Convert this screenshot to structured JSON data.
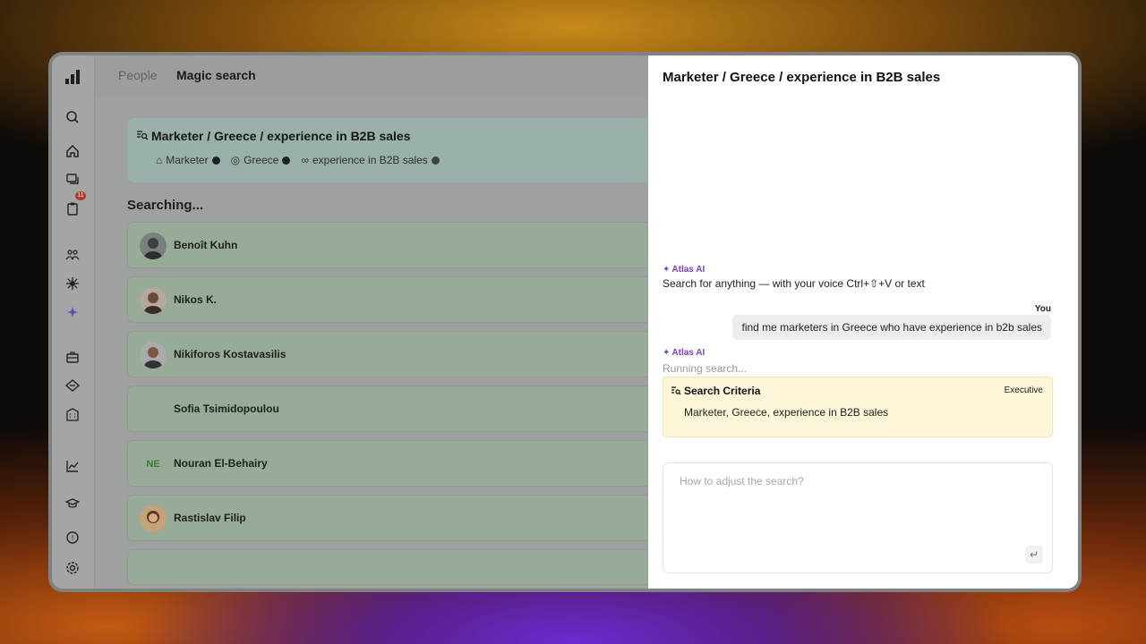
{
  "topnav": {
    "people": "People",
    "magic_search": "Magic search"
  },
  "rail": {
    "notifications_count": "11"
  },
  "query": {
    "title": "Marketer / Greece / experience in B2B sales",
    "chips": [
      "Marketer",
      "Greece",
      "experience in B2B sales"
    ]
  },
  "status": "Searching...",
  "people": [
    {
      "name": "Benoît Kuhn",
      "initials": ""
    },
    {
      "name": "Nikos K.",
      "initials": ""
    },
    {
      "name": "Nikiforos Kostavasilis",
      "initials": ""
    },
    {
      "name": "Sofia Tsimidopoulou",
      "initials": ""
    },
    {
      "name": "Nouran El-Behairy",
      "initials": "NE"
    },
    {
      "name": "Rastislav Filip",
      "initials": ""
    }
  ],
  "panel": {
    "title": "Marketer / Greece / experience in B2B sales",
    "ai_name": "Atlas AI",
    "ai_intro": "Search for anything — with your voice Ctrl+⇧+V or text",
    "you_label": "You",
    "user_message": "find me marketers in Greece who have experience in b2b sales",
    "running": "Running search...",
    "criteria_title": "Search Criteria",
    "criteria_tag": "Executive",
    "criteria_body": "Marketer, Greece, experience in B2B sales",
    "input_placeholder": "How to adjust the search?"
  }
}
